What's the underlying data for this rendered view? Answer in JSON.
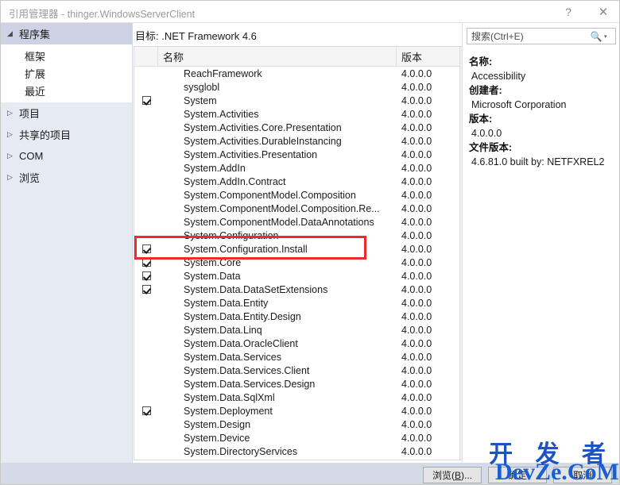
{
  "window": {
    "title_prefix": "引用管理器",
    "title_separator": " - ",
    "title_project": "thinger.WindowsServerClient",
    "title_full": "引用管理器 - thinger.WindowsServerClient",
    "help_icon": "?",
    "close_icon": "✕"
  },
  "sidebar": {
    "groups": [
      {
        "label": "程序集",
        "expanded": true,
        "selected": true,
        "arrow": "◢",
        "children": [
          {
            "label": "框架"
          },
          {
            "label": "扩展"
          },
          {
            "label": "最近"
          }
        ]
      },
      {
        "label": "项目",
        "expanded": false,
        "selected": false,
        "arrow": "▷",
        "children": []
      },
      {
        "label": "共享的项目",
        "expanded": false,
        "selected": false,
        "arrow": "▷",
        "children": []
      },
      {
        "label": "COM",
        "expanded": false,
        "selected": false,
        "arrow": "▷",
        "children": []
      },
      {
        "label": "浏览",
        "expanded": false,
        "selected": false,
        "arrow": "▷",
        "children": []
      }
    ]
  },
  "center": {
    "target_label": "目标: .NET Framework 4.6",
    "columns": {
      "check": "",
      "name": "名称",
      "version": "版本"
    },
    "rows": [
      {
        "checked": false,
        "name": "ReachFramework",
        "version": "4.0.0.0"
      },
      {
        "checked": false,
        "name": "sysglobl",
        "version": "4.0.0.0"
      },
      {
        "checked": true,
        "name": "System",
        "version": "4.0.0.0"
      },
      {
        "checked": false,
        "name": "System.Activities",
        "version": "4.0.0.0"
      },
      {
        "checked": false,
        "name": "System.Activities.Core.Presentation",
        "version": "4.0.0.0"
      },
      {
        "checked": false,
        "name": "System.Activities.DurableInstancing",
        "version": "4.0.0.0"
      },
      {
        "checked": false,
        "name": "System.Activities.Presentation",
        "version": "4.0.0.0"
      },
      {
        "checked": false,
        "name": "System.AddIn",
        "version": "4.0.0.0"
      },
      {
        "checked": false,
        "name": "System.AddIn.Contract",
        "version": "4.0.0.0"
      },
      {
        "checked": false,
        "name": "System.ComponentModel.Composition",
        "version": "4.0.0.0"
      },
      {
        "checked": false,
        "name": "System.ComponentModel.Composition.Re...",
        "version": "4.0.0.0"
      },
      {
        "checked": false,
        "name": "System.ComponentModel.DataAnnotations",
        "version": "4.0.0.0"
      },
      {
        "checked": false,
        "name": "System.Configuration",
        "version": "4.0.0.0"
      },
      {
        "checked": true,
        "name": "System.Configuration.Install",
        "version": "4.0.0.0",
        "highlighted": true
      },
      {
        "checked": true,
        "name": "System.Core",
        "version": "4.0.0.0"
      },
      {
        "checked": true,
        "name": "System.Data",
        "version": "4.0.0.0"
      },
      {
        "checked": true,
        "name": "System.Data.DataSetExtensions",
        "version": "4.0.0.0"
      },
      {
        "checked": false,
        "name": "System.Data.Entity",
        "version": "4.0.0.0"
      },
      {
        "checked": false,
        "name": "System.Data.Entity.Design",
        "version": "4.0.0.0"
      },
      {
        "checked": false,
        "name": "System.Data.Linq",
        "version": "4.0.0.0"
      },
      {
        "checked": false,
        "name": "System.Data.OracleClient",
        "version": "4.0.0.0"
      },
      {
        "checked": false,
        "name": "System.Data.Services",
        "version": "4.0.0.0"
      },
      {
        "checked": false,
        "name": "System.Data.Services.Client",
        "version": "4.0.0.0"
      },
      {
        "checked": false,
        "name": "System.Data.Services.Design",
        "version": "4.0.0.0"
      },
      {
        "checked": false,
        "name": "System.Data.SqlXml",
        "version": "4.0.0.0"
      },
      {
        "checked": true,
        "name": "System.Deployment",
        "version": "4.0.0.0"
      },
      {
        "checked": false,
        "name": "System.Design",
        "version": "4.0.0.0"
      },
      {
        "checked": false,
        "name": "System.Device",
        "version": "4.0.0.0"
      },
      {
        "checked": false,
        "name": "System.DirectoryServices",
        "version": "4.0.0.0"
      }
    ],
    "scrollbar": {
      "up_arrow": "▲",
      "down_arrow": "▼"
    }
  },
  "search": {
    "placeholder": "搜索(Ctrl+E)",
    "value": "",
    "icon": "search-icon",
    "caret": "▾"
  },
  "details": [
    {
      "key": "名称:",
      "value": "Accessibility"
    },
    {
      "key": "创建者:",
      "value": "Microsoft Corporation"
    },
    {
      "key": "版本:",
      "value": "4.0.0.0"
    },
    {
      "key": "文件版本:",
      "value": "4.6.81.0 built by: NETFXREL2"
    }
  ],
  "buttons": {
    "browse": {
      "pre": "浏览(",
      "mn": "B",
      "post": ")..."
    },
    "ok": "确定",
    "cancel": "取消"
  },
  "watermark": {
    "line1": "开 发 者",
    "line2": "DevZe.CoM",
    "color": "#1f53c4"
  },
  "colors": {
    "annotation": "#ee2b2b",
    "sidebar_bg": "#e6eaf3",
    "sidebar_selected": "#cdd3e4",
    "bottom_bar": "#d5dae8"
  }
}
